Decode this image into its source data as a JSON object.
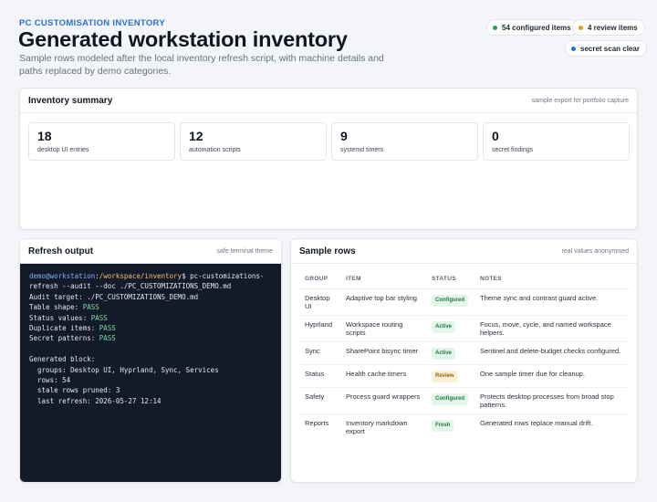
{
  "header": {
    "eyebrow": "PC CUSTOMISATION INVENTORY",
    "title": "Generated workstation inventory",
    "subtitle": "Sample rows modeled after the local inventory refresh script, with machine details and paths replaced by demo categories."
  },
  "status_pills": [
    {
      "label": "54 configured items",
      "color": "#22a355"
    },
    {
      "label": "4 review items",
      "color": "#e0a21a"
    },
    {
      "label": "secret scan clear",
      "color": "#2d6fd1"
    }
  ],
  "summary": {
    "title": "Inventory summary",
    "note": "sample export for portfolio capture",
    "stats": [
      {
        "value": "18",
        "label": "desktop UI entries"
      },
      {
        "value": "12",
        "label": "automation scripts"
      },
      {
        "value": "9",
        "label": "systemd timers"
      },
      {
        "value": "0",
        "label": "secret findings"
      }
    ]
  },
  "refresh": {
    "title": "Refresh output",
    "note": "safe terminal theme",
    "prompt_user": "demo@workstation",
    "prompt_path": "/workspace/inventory",
    "command_1": "$ pc-customizations-",
    "command_2": "refresh --audit --doc ./PC_CUSTOMIZATIONS_DEMO.md",
    "audit_target": "Audit target: ./PC_CUSTOMIZATIONS_DEMO.md",
    "checks": [
      {
        "label": "Table shape:",
        "result": "PASS"
      },
      {
        "label": "Status values:",
        "result": "PASS"
      },
      {
        "label": "Duplicate items:",
        "result": "PASS"
      },
      {
        "label": "Secret patterns:",
        "result": "PASS"
      }
    ],
    "block_title": "Generated block:",
    "block_lines": [
      "  groups: Desktop UI, Hyprland, Sync, Services",
      "  rows: 54",
      "  stale rows pruned: 3",
      "  last refresh: 2026-05-27 12:14"
    ]
  },
  "sample_rows": {
    "title": "Sample rows",
    "note": "real values anonymised",
    "columns": [
      "GROUP",
      "ITEM",
      "STATUS",
      "NOTES"
    ],
    "rows": [
      {
        "group": "Desktop UI",
        "item": "Adaptive top bar styling",
        "status": "Configured",
        "tone": "ok",
        "notes": "Theme sync and contrast guard active."
      },
      {
        "group": "Hyprland",
        "item": "Workspace routing scripts",
        "status": "Active",
        "tone": "ok",
        "notes": "Focus, move, cycle, and named workspace helpers."
      },
      {
        "group": "Sync",
        "item": "SharePoint bisync timer",
        "status": "Active",
        "tone": "ok",
        "notes": "Sentinel and delete-budget checks configured."
      },
      {
        "group": "Status",
        "item": "Health cache timers",
        "status": "Review",
        "tone": "warn",
        "notes": "One sample timer due for cleanup."
      },
      {
        "group": "Safety",
        "item": "Process guard wrappers",
        "status": "Configured",
        "tone": "ok",
        "notes": "Protects desktop processes from broad stop patterns."
      },
      {
        "group": "Reports",
        "item": "Inventory markdown export",
        "status": "Fresh",
        "tone": "ok",
        "notes": "Generated rows replace manual drift."
      }
    ]
  }
}
